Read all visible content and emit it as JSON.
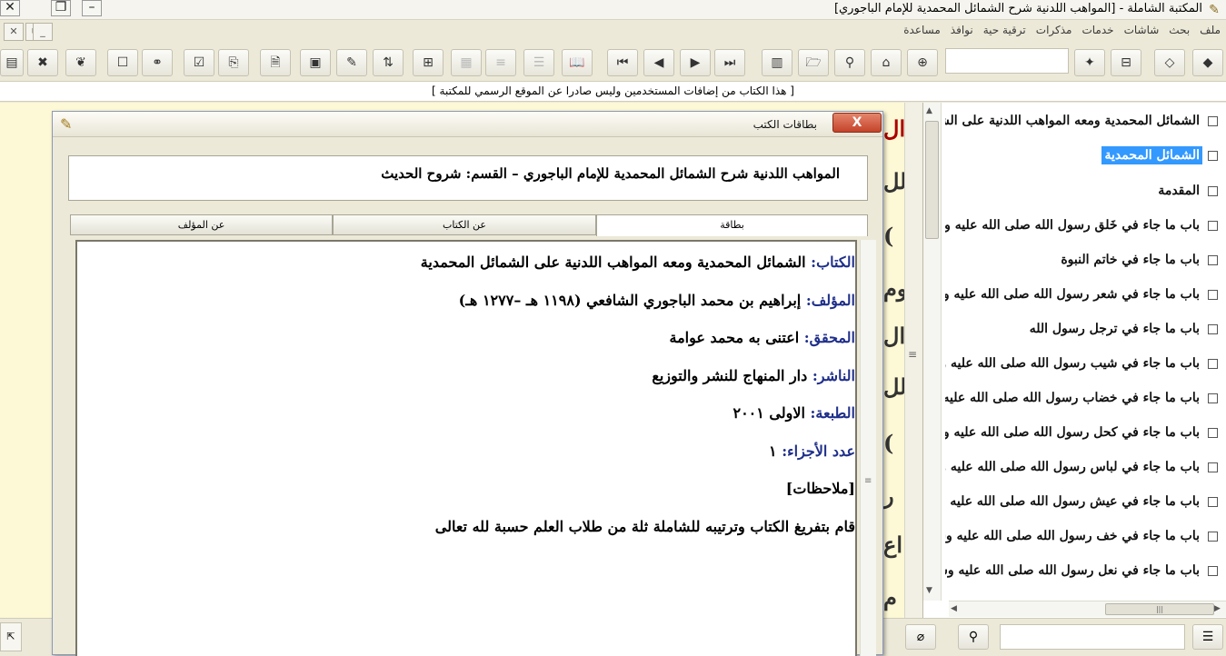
{
  "window": {
    "title": "المكتبة الشاملة - [المواهب اللدنية شرح الشمائل المحمدية للإمام الباجوري]",
    "app_icon": "book-pen-icon"
  },
  "menu": {
    "items": [
      "ملف",
      "بحث",
      "شاشات",
      "خدمات",
      "مذكرات",
      "ترقية حية",
      "نوافذ",
      "مساعدة"
    ]
  },
  "info_line": "[ هذا الكتاب من إضافات المستخدمين وليس صادرا عن الموقع الرسمي للمكتبة ]",
  "tree": {
    "items": [
      "الشمائل المحمدية ومعه المواهب اللدنية على الشمائل المحمدية",
      "الشمائل المحمدية",
      "المقدمة",
      "باب ما جاء في خَلق رسول الله صلى الله عليه وسلم",
      "باب ما جاء في خاتم النبوة",
      "باب ما جاء في شعر رسول الله صلى الله عليه وسلم",
      "باب ما جاء في ترجل رسول الله",
      "باب ما جاء في شيب رسول الله صلى الله عليه وسلم",
      "باب ما جاء في خضاب رسول الله صلى الله عليه وسلم",
      "باب ما جاء في كحل رسول الله صلى الله عليه وسلم",
      "باب ما جاء في لباس رسول الله صلى الله عليه وسلم",
      "باب ما جاء في عيش رسول الله صلى الله عليه وسلم",
      "باب ما جاء في خف رسول الله صلى الله عليه وسلم",
      "باب ما جاء في نعل رسول الله صلى الله عليه وسلم"
    ],
    "selected_index": 1
  },
  "dialog": {
    "title": "بطاقات الكتب",
    "close_label": "X",
    "header": "المواهب اللدنية شرح الشمائل المحمدية للإمام الباجوري – القسم: شروح الحديث",
    "tabs": [
      "بطاقة",
      "عن الكتاب",
      "عن المؤلف"
    ],
    "active_tab": 0,
    "card": {
      "book_key": "الكتاب:",
      "book_val": " الشمائل المحمدية ومعه المواهب اللدنية على الشمائل المحمدية",
      "author_key": "المؤلف:",
      "author_val": " إبراهيم بن محمد الباجوري الشافعي (١١٩٨ هـ –١٢٧٧ هـ)",
      "editor_key": "المحقق:",
      "editor_val": " اعتنى به محمد عوامة",
      "publisher_key": "الناشر:",
      "publisher_val": " دار المنهاج للنشر والتوزيع",
      "edition_key": "الطبعة:",
      "edition_val": " الاولى ٢٠٠١",
      "parts_key": "عدد الأجزاء:",
      "parts_val": " ١",
      "notes_label": "[ملاحظات]",
      "notes_text": "قام بتفريغ الكتاب وترتيبه للشاملة ثلة من طلاب العلم حسبة لله تعالى"
    }
  },
  "reader_glyphs": [
    "ال",
    "لل",
    "(",
    "وم",
    "ال",
    "لل",
    "(",
    "ر",
    "اع",
    "م"
  ]
}
